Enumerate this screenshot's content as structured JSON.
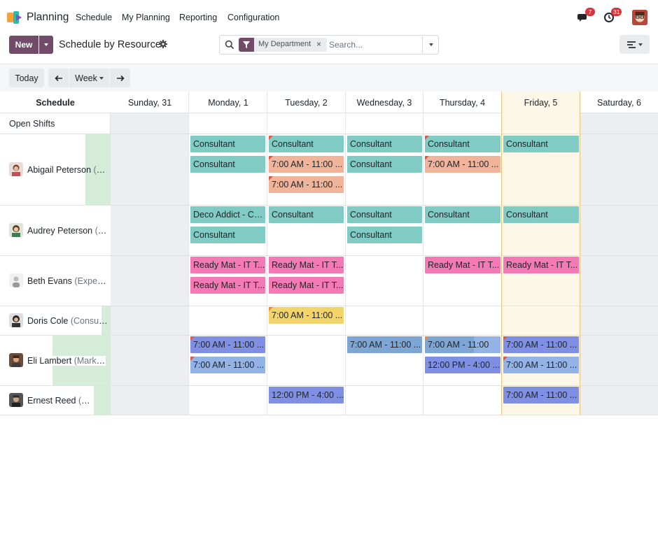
{
  "app": {
    "name": "Planning",
    "menu": [
      "Schedule",
      "My Planning",
      "Reporting",
      "Configuration"
    ],
    "messages_count": "7",
    "activities_count": "31"
  },
  "control": {
    "new_label": "New",
    "title": "Schedule by Resource",
    "facet_label": "My Department",
    "search_placeholder": "Search..."
  },
  "toolbar": {
    "today_label": "Today",
    "scale_label": "Week"
  },
  "grid": {
    "first_column_header": "Schedule",
    "days": [
      "Sunday, 31",
      "Monday, 1",
      "Tuesday, 2",
      "Wednesday, 3",
      "Thursday, 4",
      "Friday, 5",
      "Saturday, 6"
    ],
    "open_shifts_label": "Open Shifts",
    "resources": [
      {
        "name": "Abigail Peterson",
        "sub": "(C..."
      },
      {
        "name": "Audrey Peterson",
        "sub": "(C..."
      },
      {
        "name": "Beth Evans",
        "sub": "(Experie..."
      },
      {
        "name": "Doris Cole",
        "sub": "(Consult..."
      },
      {
        "name": "Eli Lambert",
        "sub": "(Market..."
      },
      {
        "name": "Ernest Reed",
        "sub": "(Consu..."
      }
    ]
  },
  "shifts": {
    "abigail": [
      "Consultant",
      "Consultant",
      "Consultant",
      "Consultant",
      "Consultant",
      "Consultant",
      "7:00 AM - 11:00 ...",
      "Consultant",
      "7:00 AM - 11:00 ...",
      "7:00 AM - 11:00 ..."
    ],
    "audrey": [
      "Deco Addict - Co...",
      "Consultant",
      "Consultant",
      "Consultant",
      "Consultant",
      "Consultant",
      "Consultant"
    ],
    "beth": [
      "Ready Mat - IT T...",
      "Ready Mat - IT T...",
      "Ready Mat - IT T...",
      "Ready Mat - IT T...",
      "Ready Mat - IT T...",
      "Ready Mat - IT T..."
    ],
    "doris": [
      "7:00 AM - 11:00 ..."
    ],
    "eli": [
      "7:00 AM - 11:00 ...",
      "7:00 AM - 11:00 ...",
      "7:00 AM - 11:00 ...",
      "7:00 AM - 11:00",
      "12:00 PM - 4:00 ...",
      "7:00 AM - 11:00 ...",
      "7:00 AM - 11:00 ..."
    ],
    "ernest": [
      "12:00 PM - 4:00 ...",
      "7:00 AM - 11:00 ..."
    ]
  },
  "colors": {
    "brand": "#714b67",
    "consultant": "#80cbc4",
    "salmon": "#f0b49a",
    "pink": "#f37ab5",
    "yellow": "#f2d46a",
    "blue": "#93b3e6",
    "indigo": "#7f8fe3"
  }
}
